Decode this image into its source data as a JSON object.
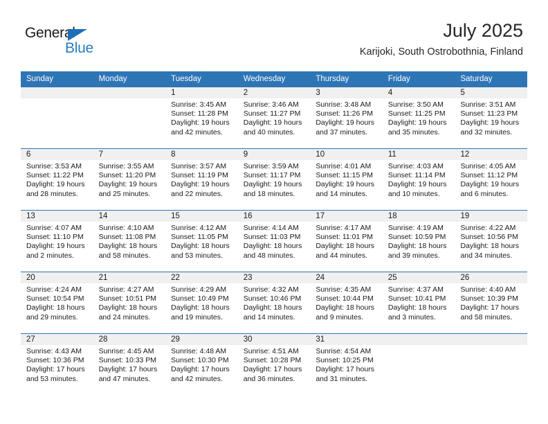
{
  "brand": {
    "name_part1": "General",
    "name_part2": "Blue",
    "accent_color": "#2a7ac0",
    "triangle_color": "#1f6fb8"
  },
  "header": {
    "month_title": "July 2025",
    "location": "Karijoki, South Ostrobothnia, Finland"
  },
  "theme": {
    "header_blue": "#2e75b6",
    "daynum_band": "#f0f0f0",
    "text": "#1a1a1a"
  },
  "calendar": {
    "weekday_headers": [
      "Sunday",
      "Monday",
      "Tuesday",
      "Wednesday",
      "Thursday",
      "Friday",
      "Saturday"
    ],
    "weeks": [
      [
        {
          "day": "",
          "sunrise": "",
          "sunset": "",
          "daylight_line1": "",
          "daylight_line2": ""
        },
        {
          "day": "",
          "sunrise": "",
          "sunset": "",
          "daylight_line1": "",
          "daylight_line2": ""
        },
        {
          "day": "1",
          "sunrise": "Sunrise: 3:45 AM",
          "sunset": "Sunset: 11:28 PM",
          "daylight_line1": "Daylight: 19 hours",
          "daylight_line2": "and 42 minutes."
        },
        {
          "day": "2",
          "sunrise": "Sunrise: 3:46 AM",
          "sunset": "Sunset: 11:27 PM",
          "daylight_line1": "Daylight: 19 hours",
          "daylight_line2": "and 40 minutes."
        },
        {
          "day": "3",
          "sunrise": "Sunrise: 3:48 AM",
          "sunset": "Sunset: 11:26 PM",
          "daylight_line1": "Daylight: 19 hours",
          "daylight_line2": "and 37 minutes."
        },
        {
          "day": "4",
          "sunrise": "Sunrise: 3:50 AM",
          "sunset": "Sunset: 11:25 PM",
          "daylight_line1": "Daylight: 19 hours",
          "daylight_line2": "and 35 minutes."
        },
        {
          "day": "5",
          "sunrise": "Sunrise: 3:51 AM",
          "sunset": "Sunset: 11:23 PM",
          "daylight_line1": "Daylight: 19 hours",
          "daylight_line2": "and 32 minutes."
        }
      ],
      [
        {
          "day": "6",
          "sunrise": "Sunrise: 3:53 AM",
          "sunset": "Sunset: 11:22 PM",
          "daylight_line1": "Daylight: 19 hours",
          "daylight_line2": "and 28 minutes."
        },
        {
          "day": "7",
          "sunrise": "Sunrise: 3:55 AM",
          "sunset": "Sunset: 11:20 PM",
          "daylight_line1": "Daylight: 19 hours",
          "daylight_line2": "and 25 minutes."
        },
        {
          "day": "8",
          "sunrise": "Sunrise: 3:57 AM",
          "sunset": "Sunset: 11:19 PM",
          "daylight_line1": "Daylight: 19 hours",
          "daylight_line2": "and 22 minutes."
        },
        {
          "day": "9",
          "sunrise": "Sunrise: 3:59 AM",
          "sunset": "Sunset: 11:17 PM",
          "daylight_line1": "Daylight: 19 hours",
          "daylight_line2": "and 18 minutes."
        },
        {
          "day": "10",
          "sunrise": "Sunrise: 4:01 AM",
          "sunset": "Sunset: 11:15 PM",
          "daylight_line1": "Daylight: 19 hours",
          "daylight_line2": "and 14 minutes."
        },
        {
          "day": "11",
          "sunrise": "Sunrise: 4:03 AM",
          "sunset": "Sunset: 11:14 PM",
          "daylight_line1": "Daylight: 19 hours",
          "daylight_line2": "and 10 minutes."
        },
        {
          "day": "12",
          "sunrise": "Sunrise: 4:05 AM",
          "sunset": "Sunset: 11:12 PM",
          "daylight_line1": "Daylight: 19 hours",
          "daylight_line2": "and 6 minutes."
        }
      ],
      [
        {
          "day": "13",
          "sunrise": "Sunrise: 4:07 AM",
          "sunset": "Sunset: 11:10 PM",
          "daylight_line1": "Daylight: 19 hours",
          "daylight_line2": "and 2 minutes."
        },
        {
          "day": "14",
          "sunrise": "Sunrise: 4:10 AM",
          "sunset": "Sunset: 11:08 PM",
          "daylight_line1": "Daylight: 18 hours",
          "daylight_line2": "and 58 minutes."
        },
        {
          "day": "15",
          "sunrise": "Sunrise: 4:12 AM",
          "sunset": "Sunset: 11:05 PM",
          "daylight_line1": "Daylight: 18 hours",
          "daylight_line2": "and 53 minutes."
        },
        {
          "day": "16",
          "sunrise": "Sunrise: 4:14 AM",
          "sunset": "Sunset: 11:03 PM",
          "daylight_line1": "Daylight: 18 hours",
          "daylight_line2": "and 48 minutes."
        },
        {
          "day": "17",
          "sunrise": "Sunrise: 4:17 AM",
          "sunset": "Sunset: 11:01 PM",
          "daylight_line1": "Daylight: 18 hours",
          "daylight_line2": "and 44 minutes."
        },
        {
          "day": "18",
          "sunrise": "Sunrise: 4:19 AM",
          "sunset": "Sunset: 10:59 PM",
          "daylight_line1": "Daylight: 18 hours",
          "daylight_line2": "and 39 minutes."
        },
        {
          "day": "19",
          "sunrise": "Sunrise: 4:22 AM",
          "sunset": "Sunset: 10:56 PM",
          "daylight_line1": "Daylight: 18 hours",
          "daylight_line2": "and 34 minutes."
        }
      ],
      [
        {
          "day": "20",
          "sunrise": "Sunrise: 4:24 AM",
          "sunset": "Sunset: 10:54 PM",
          "daylight_line1": "Daylight: 18 hours",
          "daylight_line2": "and 29 minutes."
        },
        {
          "day": "21",
          "sunrise": "Sunrise: 4:27 AM",
          "sunset": "Sunset: 10:51 PM",
          "daylight_line1": "Daylight: 18 hours",
          "daylight_line2": "and 24 minutes."
        },
        {
          "day": "22",
          "sunrise": "Sunrise: 4:29 AM",
          "sunset": "Sunset: 10:49 PM",
          "daylight_line1": "Daylight: 18 hours",
          "daylight_line2": "and 19 minutes."
        },
        {
          "day": "23",
          "sunrise": "Sunrise: 4:32 AM",
          "sunset": "Sunset: 10:46 PM",
          "daylight_line1": "Daylight: 18 hours",
          "daylight_line2": "and 14 minutes."
        },
        {
          "day": "24",
          "sunrise": "Sunrise: 4:35 AM",
          "sunset": "Sunset: 10:44 PM",
          "daylight_line1": "Daylight: 18 hours",
          "daylight_line2": "and 9 minutes."
        },
        {
          "day": "25",
          "sunrise": "Sunrise: 4:37 AM",
          "sunset": "Sunset: 10:41 PM",
          "daylight_line1": "Daylight: 18 hours",
          "daylight_line2": "and 3 minutes."
        },
        {
          "day": "26",
          "sunrise": "Sunrise: 4:40 AM",
          "sunset": "Sunset: 10:39 PM",
          "daylight_line1": "Daylight: 17 hours",
          "daylight_line2": "and 58 minutes."
        }
      ],
      [
        {
          "day": "27",
          "sunrise": "Sunrise: 4:43 AM",
          "sunset": "Sunset: 10:36 PM",
          "daylight_line1": "Daylight: 17 hours",
          "daylight_line2": "and 53 minutes."
        },
        {
          "day": "28",
          "sunrise": "Sunrise: 4:45 AM",
          "sunset": "Sunset: 10:33 PM",
          "daylight_line1": "Daylight: 17 hours",
          "daylight_line2": "and 47 minutes."
        },
        {
          "day": "29",
          "sunrise": "Sunrise: 4:48 AM",
          "sunset": "Sunset: 10:30 PM",
          "daylight_line1": "Daylight: 17 hours",
          "daylight_line2": "and 42 minutes."
        },
        {
          "day": "30",
          "sunrise": "Sunrise: 4:51 AM",
          "sunset": "Sunset: 10:28 PM",
          "daylight_line1": "Daylight: 17 hours",
          "daylight_line2": "and 36 minutes."
        },
        {
          "day": "31",
          "sunrise": "Sunrise: 4:54 AM",
          "sunset": "Sunset: 10:25 PM",
          "daylight_line1": "Daylight: 17 hours",
          "daylight_line2": "and 31 minutes."
        },
        {
          "day": "",
          "sunrise": "",
          "sunset": "",
          "daylight_line1": "",
          "daylight_line2": ""
        },
        {
          "day": "",
          "sunrise": "",
          "sunset": "",
          "daylight_line1": "",
          "daylight_line2": ""
        }
      ]
    ]
  }
}
